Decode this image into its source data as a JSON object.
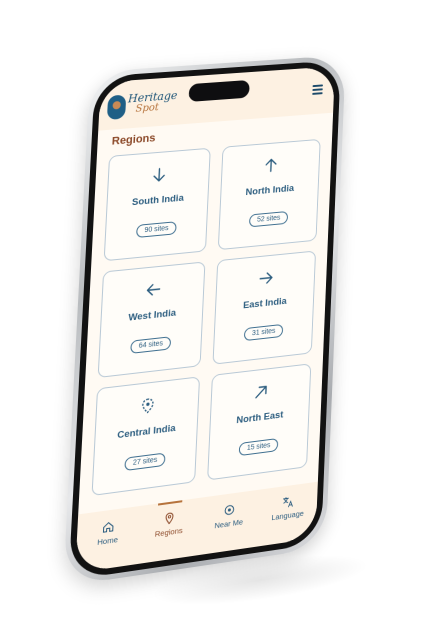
{
  "app": {
    "logo_line1": "Heritage",
    "logo_line2": "Spot"
  },
  "header": {
    "menu_icon": "hamburger-icon"
  },
  "section": {
    "title": "Regions"
  },
  "regions": [
    {
      "name": "South India",
      "count": "90 sites",
      "icon": "arrow-down-icon"
    },
    {
      "name": "North India",
      "count": "52 sites",
      "icon": "arrow-up-icon"
    },
    {
      "name": "West India",
      "count": "64 sites",
      "icon": "arrow-left-icon"
    },
    {
      "name": "East India",
      "count": "31 sites",
      "icon": "arrow-right-icon"
    },
    {
      "name": "Central India",
      "count": "27 sites",
      "icon": "location-target-icon"
    },
    {
      "name": "North East",
      "count": "15 sites",
      "icon": "arrow-up-right-icon"
    }
  ],
  "bottom_nav": [
    {
      "label": "Home",
      "icon": "home-icon",
      "active": false
    },
    {
      "label": "Regions",
      "icon": "map-pin-icon",
      "active": true
    },
    {
      "label": "Near Me",
      "icon": "near-me-icon",
      "active": false
    },
    {
      "label": "Language",
      "icon": "translate-icon",
      "active": false
    }
  ],
  "colors": {
    "accent": "#b6733c",
    "primary": "#2d5e80",
    "background": "#fffaf3",
    "header": "#fdf1e2"
  }
}
